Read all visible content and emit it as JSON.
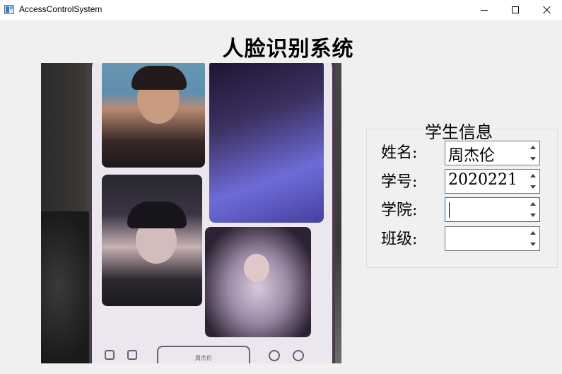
{
  "window": {
    "title": "AccessControlSystem",
    "icon": "app-window-icon"
  },
  "controls": {
    "minimize_icon": "minimize-icon",
    "maximize_icon": "maximize-icon",
    "close_icon": "close-icon"
  },
  "header": {
    "title": "人脸识别系统"
  },
  "camera": {
    "phone_screen_button_text": "周杰伦"
  },
  "student_info": {
    "group_title": "学生信息",
    "fields": [
      {
        "label": "姓名:",
        "value": "周杰伦"
      },
      {
        "label": "学号:",
        "value": "2020221"
      },
      {
        "label": "学院:",
        "value": ""
      },
      {
        "label": "班级:",
        "value": ""
      }
    ]
  },
  "colors": {
    "background": "#f0f0f0",
    "focus_border": "#0078d7",
    "field_border": "#7a7a7a"
  }
}
